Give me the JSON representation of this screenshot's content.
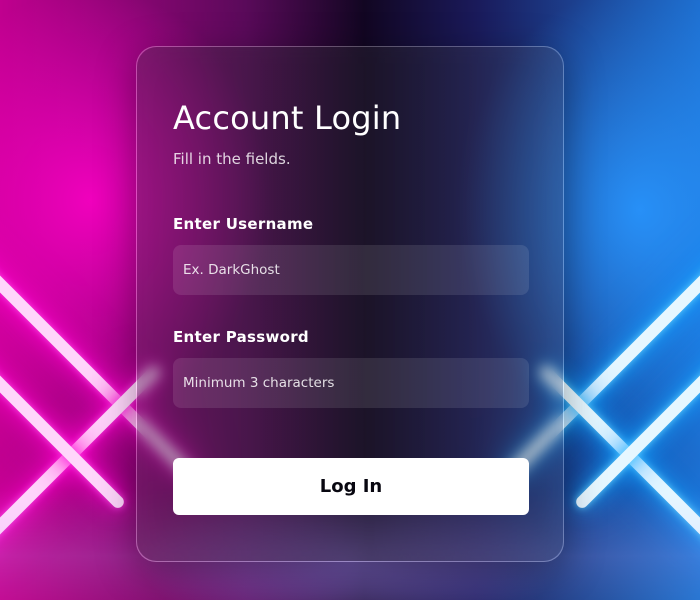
{
  "form": {
    "title": "Account Login",
    "subtitle": "Fill in the fields.",
    "username": {
      "label": "Enter Username",
      "placeholder": "Ex. DarkGhost",
      "value": ""
    },
    "password": {
      "label": "Enter Password",
      "placeholder": "Minimum 3 characters",
      "value": ""
    },
    "submit_label": "Log In"
  },
  "colors": {
    "neon_pink": "#ff00d0",
    "neon_blue": "#1fa8ff",
    "button_bg": "#ffffff",
    "button_text": "#080710"
  }
}
